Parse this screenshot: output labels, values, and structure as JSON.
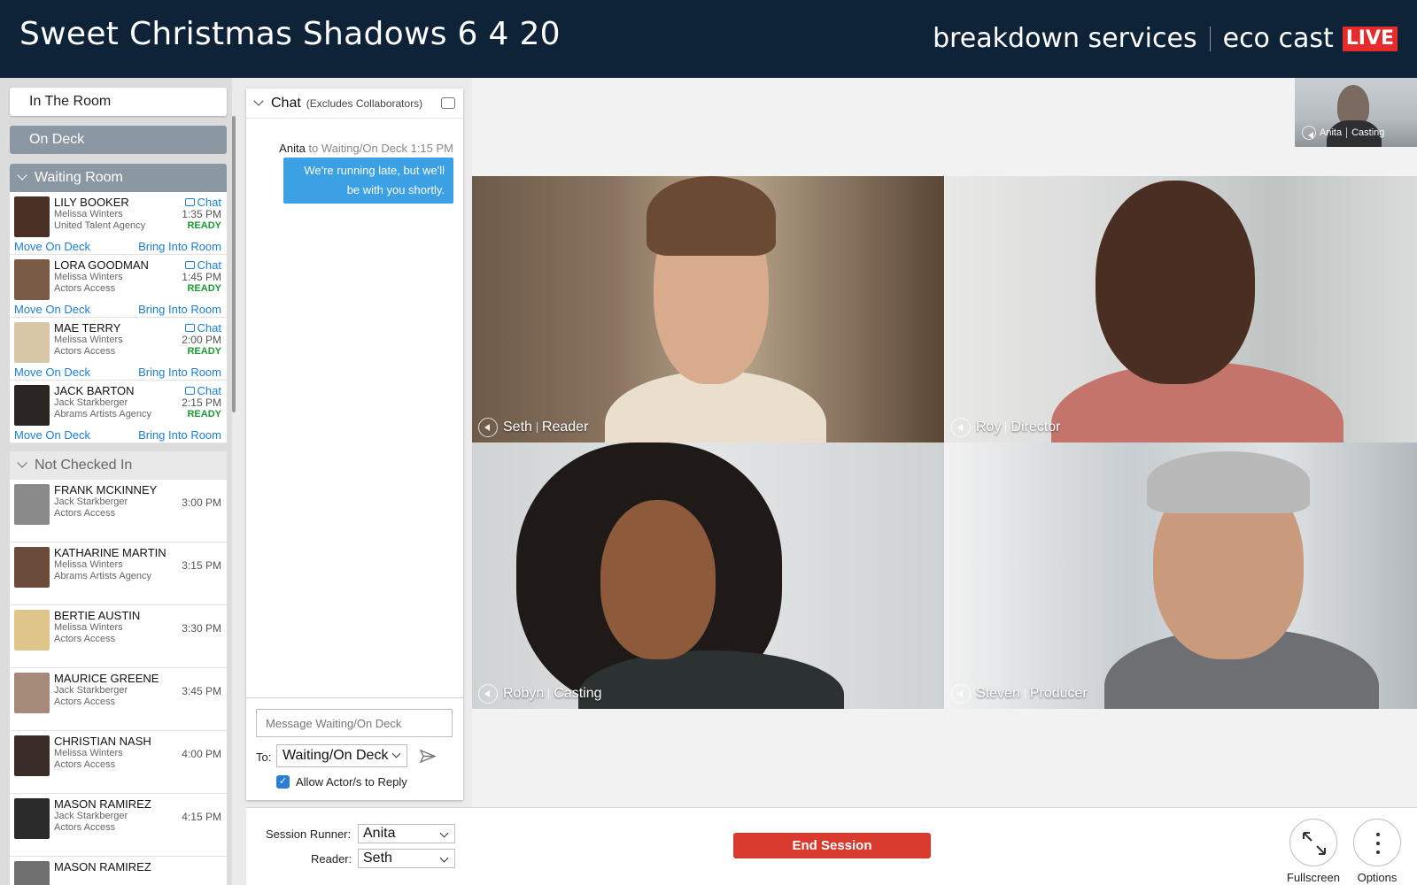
{
  "header": {
    "title": "Sweet Christmas Shadows 6 4 20",
    "brand_left": "breakdown services",
    "brand_right": "eco cast",
    "live_badge": "LIVE",
    "colors": {
      "background": "#0e2238",
      "live": "#e52b2b"
    }
  },
  "sidebar": {
    "in_the_room": "In The Room",
    "on_deck": "On Deck",
    "waiting_room": {
      "title": "Waiting Room",
      "actors": [
        {
          "name": "LILY BOOKER",
          "rep": "Melissa Winters",
          "agency": "United Talent Agency",
          "chat": "Chat",
          "time": "1:35 PM",
          "status": "READY",
          "move": "Move On Deck",
          "bring": "Bring Into Room"
        },
        {
          "name": "LORA GOODMAN",
          "rep": "Melissa Winters",
          "agency": "Actors Access",
          "chat": "Chat",
          "time": "1:45 PM",
          "status": "READY",
          "move": "Move On Deck",
          "bring": "Bring Into Room"
        },
        {
          "name": "MAE TERRY",
          "rep": "Melissa Winters",
          "agency": "Actors Access",
          "chat": "Chat",
          "time": "2:00 PM",
          "status": "READY",
          "move": "Move On Deck",
          "bring": "Bring Into Room"
        },
        {
          "name": "JACK BARTON",
          "rep": "Jack Starkberger",
          "agency": "Abrams Artists Agency",
          "chat": "Chat",
          "time": "2:15 PM",
          "status": "READY",
          "move": "Move On Deck",
          "bring": "Bring Into Room"
        }
      ]
    },
    "not_checked_in": {
      "title": "Not Checked In",
      "actors": [
        {
          "name": "FRANK MCKINNEY",
          "rep": "Jack Starkberger",
          "agency": "Actors Access",
          "time": "3:00 PM"
        },
        {
          "name": "KATHARINE MARTIN",
          "rep": "Melissa Winters",
          "agency": "Abrams Artists Agency",
          "time": "3:15 PM"
        },
        {
          "name": "BERTIE AUSTIN",
          "rep": "Melissa Winters",
          "agency": "Actors Access",
          "time": "3:30 PM"
        },
        {
          "name": "MAURICE GREENE",
          "rep": "Jack Starkberger",
          "agency": "Actors Access",
          "time": "3:45 PM"
        },
        {
          "name": "CHRISTIAN NASH",
          "rep": "Melissa Winters",
          "agency": "Actors Access",
          "time": "4:00 PM"
        },
        {
          "name": "MASON RAMIREZ",
          "rep": "Jack Starkberger",
          "agency": "Actors Access",
          "time": "4:15 PM"
        },
        {
          "name": "MASON RAMIREZ",
          "rep": "",
          "agency": "",
          "time": ""
        }
      ]
    }
  },
  "chat": {
    "title": "Chat",
    "subtitle": "(Excludes Collaborators)",
    "message": {
      "sender": "Anita",
      "target": "to Waiting/On Deck",
      "time": "1:15 PM",
      "text": "We're running late, but we'll be with you shortly."
    },
    "input_placeholder": "Message Waiting/On Deck",
    "to_label": "To:",
    "to_value": "Waiting/On Deck",
    "allow_reply": "Allow Actor/s to Reply",
    "allow_reply_checked": true
  },
  "video": {
    "self_view": {
      "name": "Anita",
      "role": "Casting"
    },
    "tiles": [
      {
        "name": "Seth",
        "role": "Reader"
      },
      {
        "name": "Roy",
        "role": "Director"
      },
      {
        "name": "Robyn",
        "role": "Casting"
      },
      {
        "name": "Steven",
        "role": "Producer"
      }
    ]
  },
  "bottom": {
    "session_runner_label": "Session Runner:",
    "session_runner_value": "Anita",
    "reader_label": "Reader:",
    "reader_value": "Seth",
    "end_session": "End Session",
    "fullscreen": "Fullscreen",
    "options": "Options"
  }
}
